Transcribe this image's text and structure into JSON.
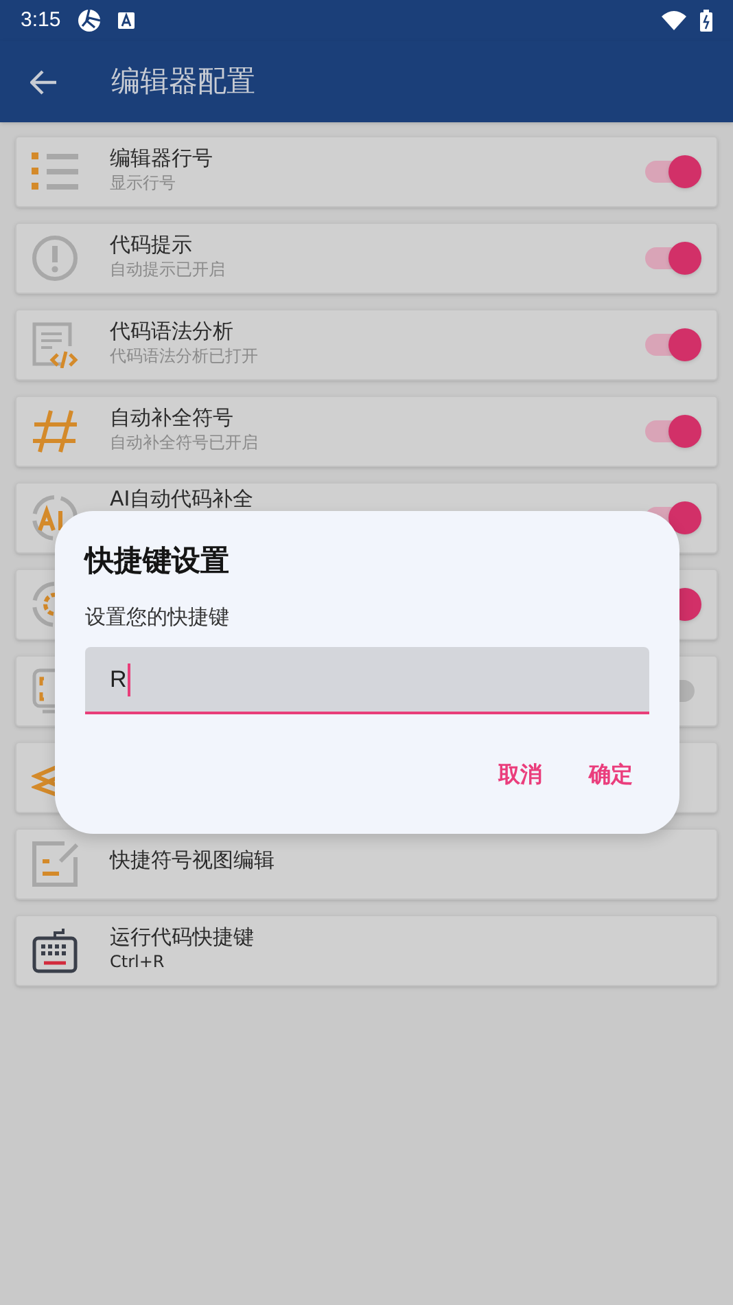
{
  "status_bar": {
    "time": "3:15"
  },
  "app_bar": {
    "title": "编辑器配置"
  },
  "settings": [
    {
      "kind": "toggle",
      "title": "编辑器行号",
      "subtitle": "显示行号",
      "on": true
    },
    {
      "kind": "toggle",
      "title": "代码提示",
      "subtitle": "自动提示已开启",
      "on": true
    },
    {
      "kind": "toggle",
      "title": "代码语法分析",
      "subtitle": "代码语法分析已打开",
      "on": true
    },
    {
      "kind": "toggle",
      "title": "自动补全符号",
      "subtitle": "自动补全符号已开启",
      "on": true
    },
    {
      "kind": "toggle",
      "title": "AI自动代码补全",
      "on": true
    },
    {
      "kind": "toggle",
      "on": true
    },
    {
      "kind": "toggle",
      "on": false
    },
    {
      "kind": "plain"
    },
    {
      "kind": "plain",
      "title": "快捷符号视图编辑"
    },
    {
      "kind": "plain",
      "title": "运行代码快捷键",
      "subtitle": "Ctrl+R"
    }
  ],
  "dialog": {
    "title": "快捷键设置",
    "message": "设置您的快捷键",
    "input_value": "R",
    "buttons": [
      "取消",
      "确定"
    ]
  }
}
